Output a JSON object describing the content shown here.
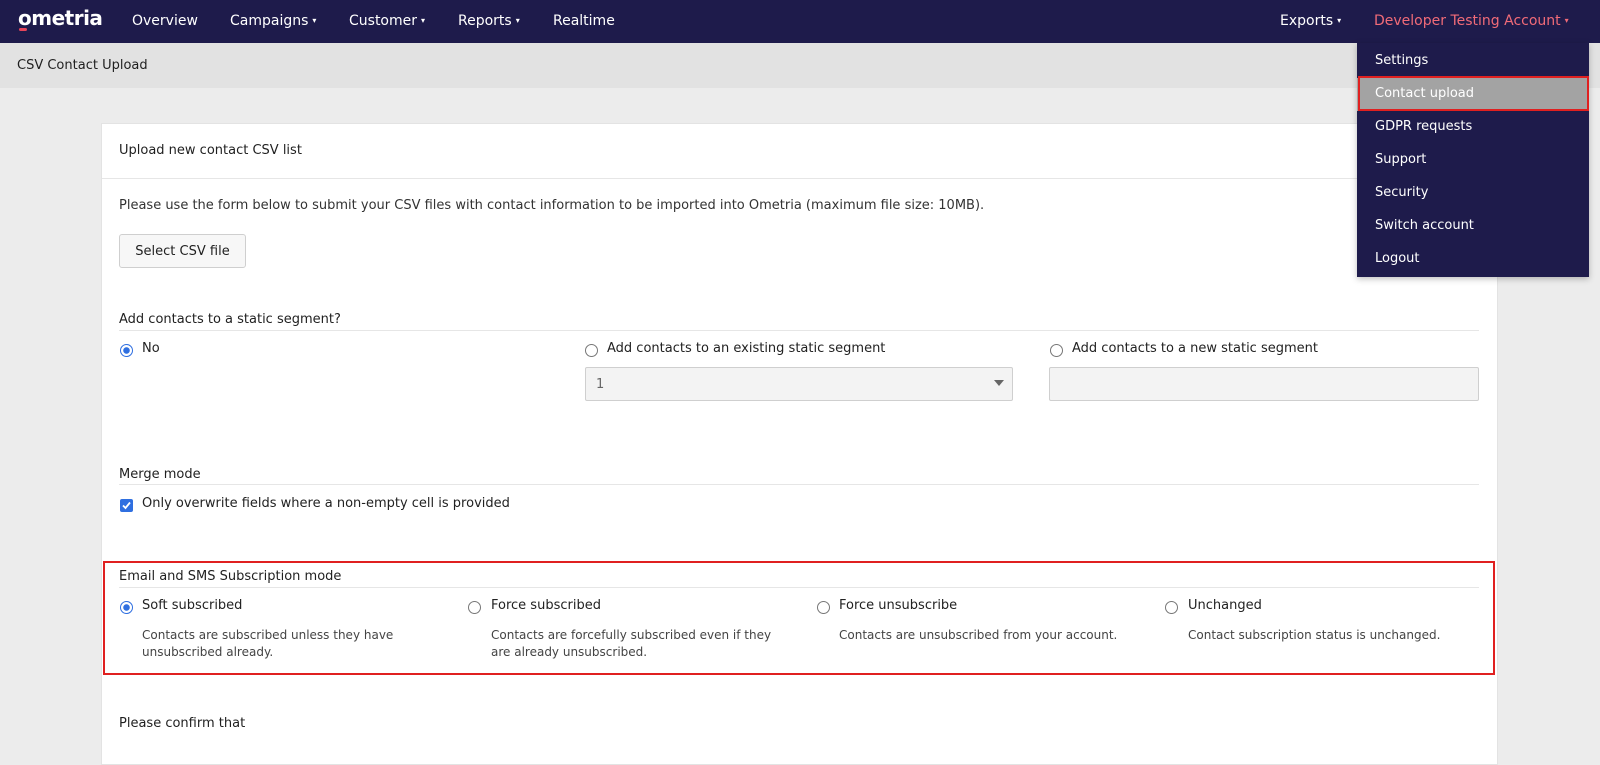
{
  "nav": {
    "logo": "ometria",
    "items": [
      {
        "label": "Overview",
        "has_caret": false
      },
      {
        "label": "Campaigns",
        "has_caret": true
      },
      {
        "label": "Customer",
        "has_caret": true
      },
      {
        "label": "Reports",
        "has_caret": true
      },
      {
        "label": "Realtime",
        "has_caret": false
      }
    ],
    "exports_label": "Exports",
    "account_label": "Developer Testing Account",
    "caret_icon": "▾"
  },
  "subheader": {
    "title": "CSV Contact Upload"
  },
  "account_menu": {
    "items": [
      "Settings",
      "Contact upload",
      "GDPR requests",
      "Support",
      "Security",
      "Switch account",
      "Logout"
    ],
    "active": "Contact upload"
  },
  "card": {
    "title": "Upload new contact CSV list",
    "intro": "Please use the form below to submit your CSV files with contact information to be imported into Ometria (maximum file size: 10MB).",
    "select_button": "Select CSV file"
  },
  "segment": {
    "title": "Add contacts to a static segment?",
    "options": [
      "No",
      "Add contacts to an existing static segment",
      "Add contacts to a new static segment"
    ],
    "selected": "No",
    "existing_segment_value": "1",
    "new_segment_value": ""
  },
  "merge": {
    "title": "Merge mode",
    "checkbox_label": "Only overwrite fields where a non-empty cell is provided",
    "checked": true
  },
  "subscription": {
    "title": "Email and SMS Subscription mode",
    "options": [
      {
        "label": "Soft subscribed",
        "desc": "Contacts are subscribed unless they have unsubscribed already."
      },
      {
        "label": "Force subscribed",
        "desc": "Contacts are forcefully subscribed even if they are already unsubscribed."
      },
      {
        "label": "Force unsubscribe",
        "desc": "Contacts are unsubscribed from your account."
      },
      {
        "label": "Unchanged",
        "desc": "Contact subscription status is unchanged."
      }
    ],
    "selected": "Soft subscribed"
  },
  "confirm": {
    "title": "Please confirm that"
  },
  "colors": {
    "nav_bg": "#1e1b4b",
    "account_accent": "#f16b78",
    "radio_checked": "#2f6fe0",
    "highlight": "#e02020",
    "menu_active_bg": "#a3a3a3"
  }
}
